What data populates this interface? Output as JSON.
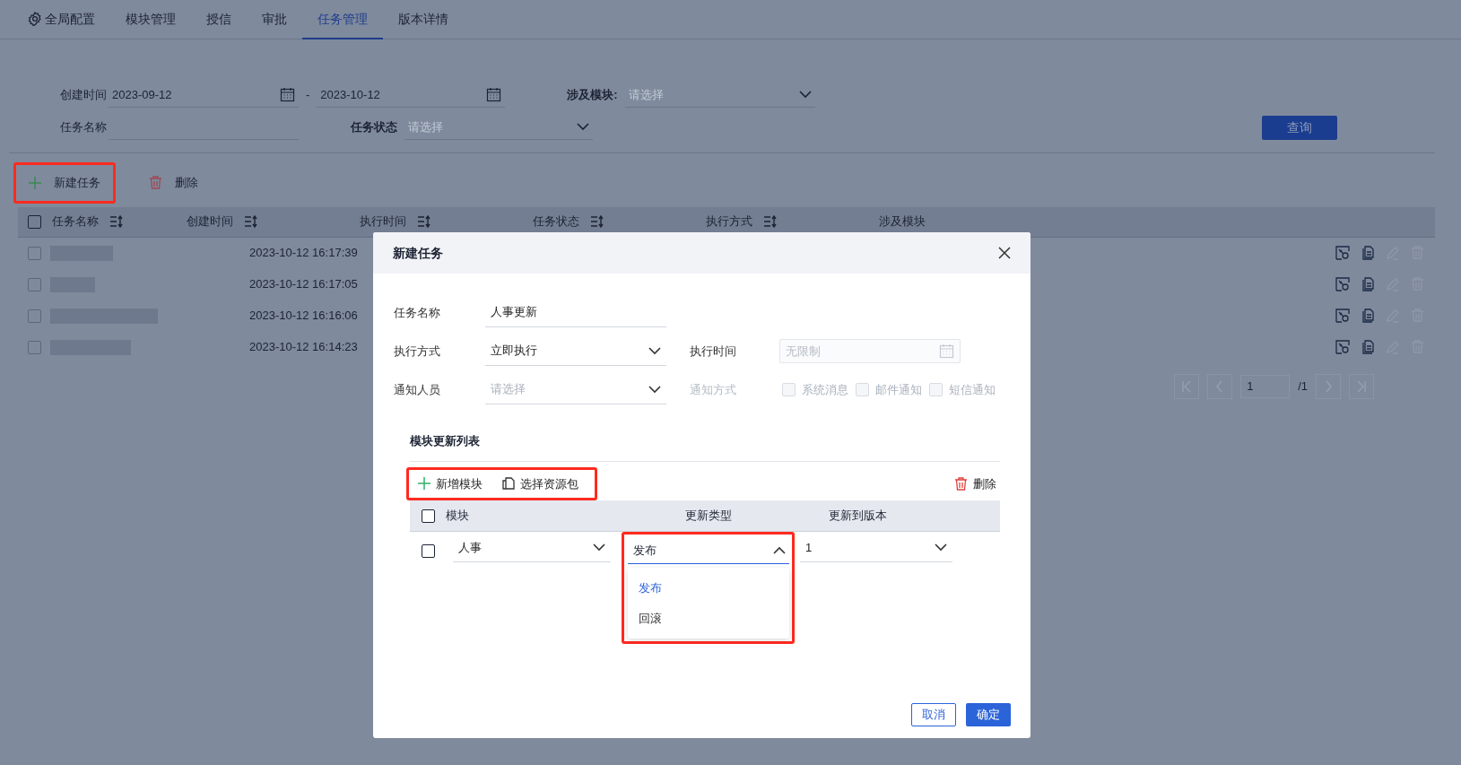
{
  "nav": {
    "tabs": [
      {
        "label": "全局配置",
        "kind": "gear",
        "selected": false
      },
      {
        "label": "模块管理",
        "kind": "plain",
        "selected": false
      },
      {
        "label": "授信",
        "kind": "plain",
        "selected": false
      },
      {
        "label": "审批",
        "kind": "plain",
        "selected": false
      },
      {
        "label": "任务管理",
        "kind": "plain",
        "selected": true
      },
      {
        "label": "版本详情",
        "kind": "plain",
        "selected": false
      }
    ]
  },
  "filters": {
    "created_label": "创建时间",
    "date_from": "2023-09-12",
    "date_sep": "-",
    "date_to": "2023-10-12",
    "module_label": "涉及模块:",
    "module_placeholder": "请选择",
    "name_label": "任务名称",
    "status_label": "任务状态",
    "status_placeholder": "请选择",
    "query_button": "查询"
  },
  "toolbar": {
    "new_button": {
      "label": "新建任务",
      "highlighted": true
    },
    "delete_button": "删除"
  },
  "table": {
    "columns": [
      {
        "label": "任务名称",
        "sortable": true
      },
      {
        "label": "创建时间",
        "sortable": true
      },
      {
        "label": "执行时间",
        "sortable": true
      },
      {
        "label": "任务状态",
        "sortable": true
      },
      {
        "label": "执行方式",
        "sortable": true
      },
      {
        "label": "涉及模块",
        "sortable": false
      }
    ],
    "all_checked": false,
    "rows": [
      {
        "checked": false,
        "created": "2023-10-12 16:17:39"
      },
      {
        "checked": false,
        "created": "2023-10-12 16:17:05"
      },
      {
        "checked": false,
        "created": "2023-10-12 16:16:06"
      },
      {
        "checked": false,
        "created": "2023-10-12 16:14:23"
      }
    ],
    "row_actions": [
      {
        "kind": "key",
        "disabled": false
      },
      {
        "kind": "docs",
        "disabled": false
      },
      {
        "kind": "edit",
        "disabled": true
      },
      {
        "kind": "trash",
        "disabled": true
      }
    ]
  },
  "pagination": {
    "page": "1",
    "total": "/1"
  },
  "modal": {
    "title": "新建任务",
    "name_label": "任务名称",
    "name_value": "人事更新",
    "mode_label": "执行方式",
    "mode_value": "立即执行",
    "time_label": "执行时间",
    "time_placeholder": "无限制",
    "notify_label": "通知人员",
    "notify_placeholder": "请选择",
    "method_label": "通知方式",
    "methods_disabled": true,
    "methods": [
      {
        "label": "系统消息",
        "checked": false
      },
      {
        "label": "邮件通知",
        "checked": false
      },
      {
        "label": "短信通知",
        "checked": false
      }
    ],
    "all_checked": false,
    "section_title": "模块更新列表",
    "add_button": "新增模块",
    "pack_button": "选择资源包",
    "toolbar_highlighted": true,
    "delete_button": "删除",
    "columns": [
      "模块",
      "更新类型",
      "更新到版本"
    ],
    "rows": [
      {
        "checked": false,
        "module": "人事",
        "type": "发布",
        "version": "1",
        "type_open": true
      }
    ],
    "type_options": [
      {
        "label": "发布",
        "selected": true
      },
      {
        "label": "回滚",
        "selected": false
      }
    ],
    "dropdown_highlighted": true,
    "cancel": "取消",
    "ok": "确定"
  }
}
